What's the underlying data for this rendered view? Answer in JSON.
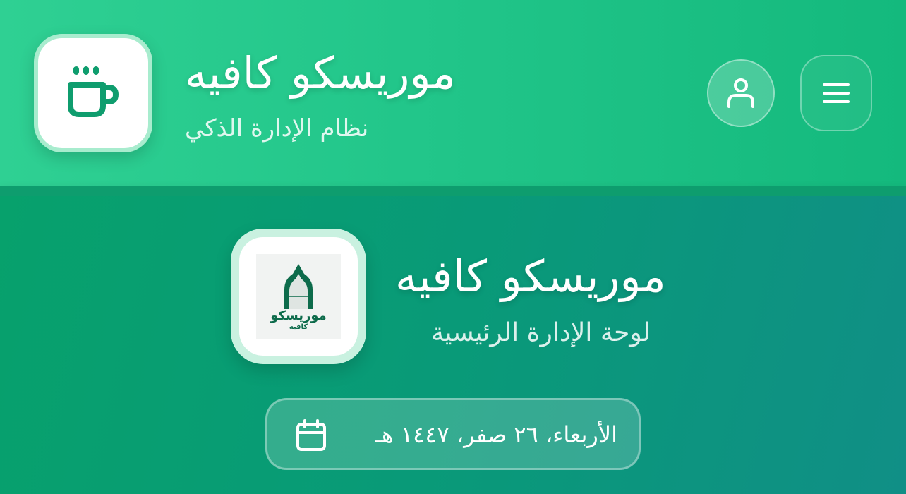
{
  "header": {
    "title": "موريسكو كافيه",
    "subtitle": "نظام الإدارة الذكي",
    "app_icon": "coffee-cup-icon",
    "user_button_icon": "user-icon",
    "menu_button_icon": "menu-icon"
  },
  "main": {
    "logo": {
      "arch_text": "موريسكو",
      "arch_subtext": "كافيه"
    },
    "title": "موريسكو كافيه",
    "subtitle": "لوحة الإدارة الرئيسية",
    "date": {
      "icon": "calendar-icon",
      "text": "الأربعاء، ٢٦ صفر، ١٤٤٧ هـ"
    }
  },
  "colors": {
    "brand_green": "#0f9d6e",
    "header_gradient_start": "#2fd093",
    "header_gradient_end": "#14b97d",
    "main_gradient_start": "#07a16c",
    "main_gradient_end": "#108f86"
  }
}
